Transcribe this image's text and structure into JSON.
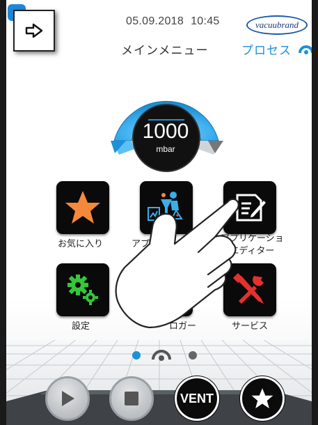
{
  "header": {
    "date": "05.09.2018",
    "time": "10:45",
    "logo_text": "vacuubrand",
    "title": "メインメニュー",
    "process_label": "プロセス"
  },
  "gauge": {
    "value": "1000",
    "unit": "mbar"
  },
  "tiles": [
    {
      "label": "お気に入り",
      "icon": "star-icon"
    },
    {
      "label": "アプリ",
      "icon": "applications-icon"
    },
    {
      "label": "アプリケーショ",
      "label2": "エディター",
      "icon": "editor-icon"
    },
    {
      "label": "設定",
      "icon": "gears-icon"
    },
    {
      "label": "ロガー",
      "icon": "logger-icon"
    },
    {
      "label": "サービス",
      "icon": "tools-icon"
    }
  ],
  "pager": {
    "pages": 3,
    "active": 0
  },
  "controls": {
    "play_icon": "play-icon",
    "stop_icon": "stop-icon",
    "vent_label": "VENT",
    "favorite_icon": "star-icon"
  },
  "colors": {
    "accent_blue": "#1e90d8",
    "tile_bg": "#0a0a0a",
    "star_orange": "#f5893b",
    "gear_green": "#34c73a",
    "tools_red": "#e3312f"
  }
}
